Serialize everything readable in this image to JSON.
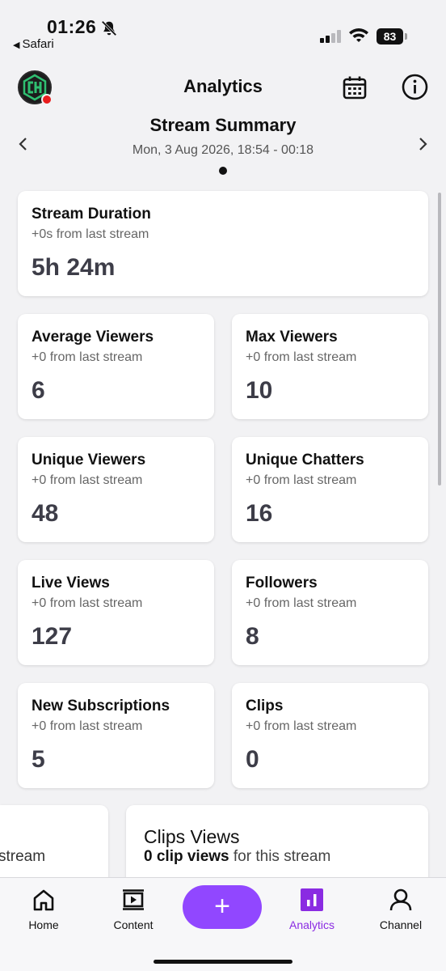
{
  "status": {
    "time": "01:26",
    "back_app": "Safari",
    "battery": "83"
  },
  "header": {
    "title": "Analytics"
  },
  "summary": {
    "title": "Stream Summary",
    "date": "Mon, 3 Aug 2026, 18:54 - 00:18"
  },
  "cards": [
    {
      "title": "Stream Duration",
      "sub": "+0s from last stream",
      "value": "5h 24m"
    },
    {
      "title": "Average Viewers",
      "sub": "+0 from last stream",
      "value": "6"
    },
    {
      "title": "Max Viewers",
      "sub": "+0 from last stream",
      "value": "10"
    },
    {
      "title": "Unique Viewers",
      "sub": "+0 from last stream",
      "value": "48"
    },
    {
      "title": "Unique Chatters",
      "sub": "+0 from last stream",
      "value": "16"
    },
    {
      "title": "Live Views",
      "sub": "+0 from last stream",
      "value": "127"
    },
    {
      "title": "Followers",
      "sub": "+0 from last stream",
      "value": "8"
    },
    {
      "title": "New Subscriptions",
      "sub": "+0 from last stream",
      "value": "5"
    },
    {
      "title": "Clips",
      "sub": "+0 from last stream",
      "value": "0"
    }
  ],
  "partial": {
    "left_sub": "stream",
    "clips_views_title": "Clips Views",
    "clips_views_bold": "0 clip views",
    "clips_views_rest": " for this stream"
  },
  "nav": {
    "home": "Home",
    "content": "Content",
    "add": "+",
    "analytics": "Analytics",
    "channel": "Channel"
  },
  "colors": {
    "accent": "#9147ff",
    "active_label": "#8a2be2",
    "live_dot": "#e81c1c"
  }
}
